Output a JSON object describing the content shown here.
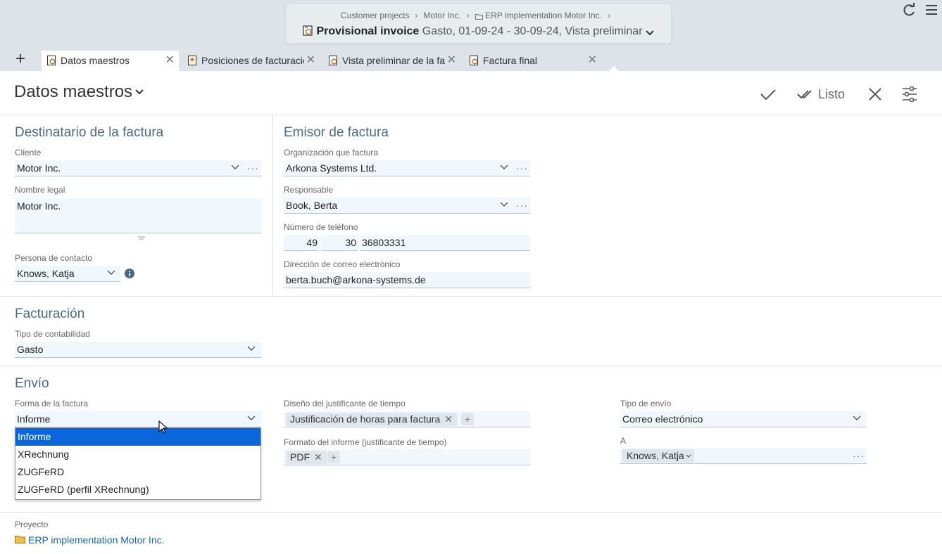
{
  "header": {
    "breadcrumbs": [
      "Customer projects",
      "Motor Inc.",
      "ERP implementation Motor Inc."
    ],
    "object_type": "Provisional invoice",
    "object_subtitle": "Gasto, 01-09-24 - 30-09-24, Vista preliminar",
    "icons": [
      "reload-icon",
      "hamburger-menu-icon"
    ]
  },
  "tabs": [
    {
      "label": "Datos maestros",
      "active": true
    },
    {
      "label": "Posiciones de facturación",
      "active": false
    },
    {
      "label": "Vista preliminar de la factura",
      "active": false
    },
    {
      "label": "Factura final",
      "active": false
    }
  ],
  "add_tab_label": "+",
  "page": {
    "title": "Datos maestros",
    "actions": {
      "done": "Listo"
    }
  },
  "recipient": {
    "title": "Destinatario de la factura",
    "client_label": "Cliente",
    "client": "Motor Inc.",
    "legal_name_label": "Nombre legal",
    "legal_name": "Motor Inc.",
    "contact_label": "Persona de contacto",
    "contact": "Knows, Katja"
  },
  "issuer": {
    "title": "Emisor de factura",
    "org_label": "Organización que factura",
    "org": "Arkona Systems Ltd.",
    "responsible_label": "Responsable",
    "responsible": "Book, Berta",
    "phone_label": "Número de teléfono",
    "phone_country": "49",
    "phone_area": "30",
    "phone_number": "36803331",
    "email_label": "Dirección de correo electrónico",
    "email": "berta.buch@arkona-systems.de"
  },
  "billing": {
    "title": "Facturación",
    "accounting_type_label": "Tipo de contabilidad",
    "accounting_type": "Gasto"
  },
  "shipping": {
    "title": "Envío",
    "invoice_form_label": "Forma de la factura",
    "invoice_form": "Informe",
    "invoice_form_options": [
      "Informe",
      "XRechnung",
      "ZUGFeRD",
      "ZUGFeRD (perfil XRechnung)"
    ],
    "time_sheet_layout_label": "Diseño del justificante de tiempo",
    "time_sheet_layout_chip": "Justificación de horas para factura",
    "report_format_label": "Formato del informe (justificante de tiempo)",
    "report_format_chip": "PDF",
    "shipping_type_label": "Tipo de envío",
    "shipping_type": "Correo electrónico",
    "to_label": "A",
    "to_chip": "Knows, Katja"
  },
  "project": {
    "label": "Proyecto",
    "value": "ERP implementation Motor Inc."
  },
  "colors": {
    "section_title": "#4e6a80",
    "field_bg": "#f0f7fd",
    "selected": "#0b66d9",
    "link": "#1a66a6"
  }
}
